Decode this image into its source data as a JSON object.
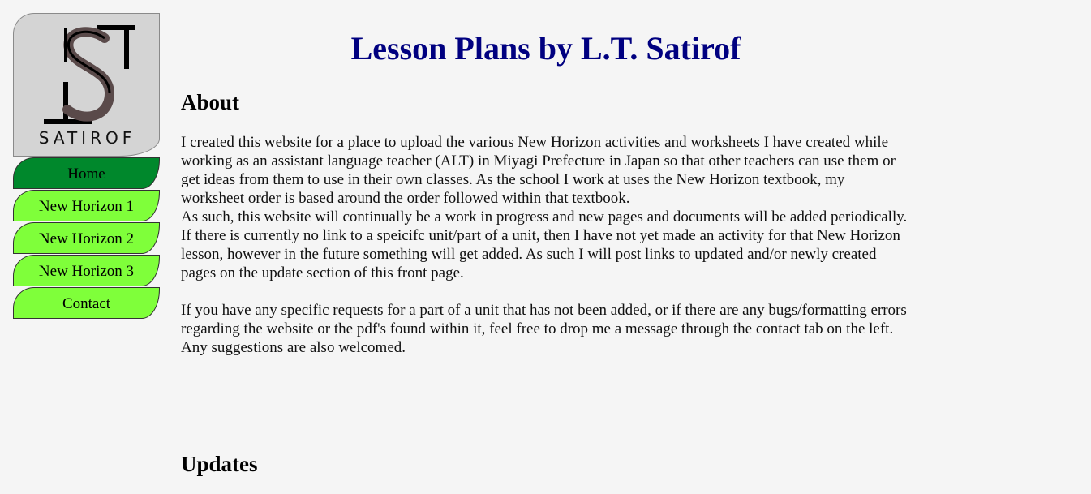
{
  "logo": {
    "wordmark": "SATIROF",
    "letters": "LST"
  },
  "nav": {
    "items": [
      {
        "label": "Home",
        "active": true
      },
      {
        "label": "New Horizon 1",
        "active": false
      },
      {
        "label": "New Horizon 2",
        "active": false
      },
      {
        "label": "New Horizon 3",
        "active": false
      },
      {
        "label": "Contact",
        "active": false
      }
    ]
  },
  "header": {
    "title": "Lesson Plans by L.T. Satirof"
  },
  "about": {
    "heading": "About",
    "paragraph_1": "I created this website for a place to upload the various New Horizon activities and worksheets I have created while working as an assistant language teacher (ALT) in Miyagi Prefecture in Japan so that other teachers can use them or get ideas from them to use in their own classes. As the school I work at uses the New Horizon textbook, my worksheet order is based around the order followed within that textbook.",
    "paragraph_2": "As such, this website will continually be a work in progress and new pages and documents will be added periodically. If there is currently no link to a speicifc unit/part of a unit, then I have not yet made an activity for that New Horizon lesson, however in the future something will get added. As such I will post links to updated and/or newly created pages on the update section of this front page.",
    "paragraph_3": "If you have any specific requests for a part of a unit that has not been added, or if there are any bugs/formatting errors regarding the website or the pdf's found within it, feel free to drop me a message through the contact tab on the left. Any suggestions are also welcomed."
  },
  "updates": {
    "heading": "Updates"
  },
  "colors": {
    "title": "#000080",
    "nav_active": "#00882c",
    "nav_default": "#7fff3a",
    "background": "#f5f5f5"
  }
}
